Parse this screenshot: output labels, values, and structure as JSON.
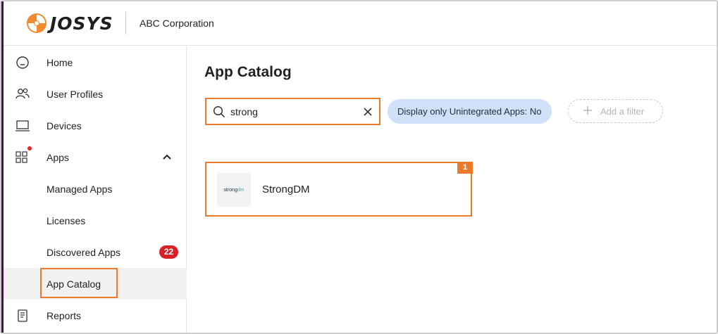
{
  "header": {
    "brand": "JOSYS",
    "org_name": "ABC Corporation"
  },
  "sidebar": {
    "items": [
      {
        "label": "Home",
        "icon": "home-icon"
      },
      {
        "label": "User Profiles",
        "icon": "users-icon"
      },
      {
        "label": "Devices",
        "icon": "laptop-icon"
      },
      {
        "label": "Apps",
        "icon": "grid-icon",
        "expanded": true
      },
      {
        "label": "Managed Apps"
      },
      {
        "label": "Licenses"
      },
      {
        "label": "Discovered Apps",
        "badge": "22"
      },
      {
        "label": "App Catalog",
        "active": true
      },
      {
        "label": "Reports",
        "icon": "report-icon"
      }
    ]
  },
  "main": {
    "title": "App Catalog",
    "search": {
      "value": "strong"
    },
    "filter_chip": "Display only Unintegrated Apps: No",
    "add_filter": "Add a filter",
    "results": [
      {
        "name": "StrongDM",
        "logo_text_a": "strong",
        "logo_text_b": "dm",
        "step": "1"
      }
    ]
  },
  "colors": {
    "accent_orange": "#ec7a2a",
    "chip_blue": "#cfe1f8",
    "badge_red": "#d91f26",
    "left_accent": "#3a1b3f"
  }
}
